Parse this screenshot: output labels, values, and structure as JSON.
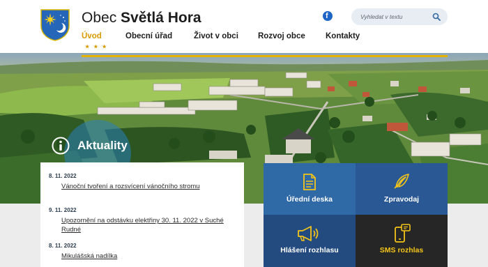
{
  "header": {
    "title_prefix": "Obec",
    "title_name": "Světlá Hora",
    "search": {
      "placeholder": "Vyhledat v textu"
    }
  },
  "nav": {
    "items": [
      {
        "label": "Úvod",
        "active": true
      },
      {
        "label": "Obecní úřad"
      },
      {
        "label": "Život v obci"
      },
      {
        "label": "Rozvoj obce"
      },
      {
        "label": "Kontakty"
      }
    ],
    "active_marker": "★ ★ ★"
  },
  "news": {
    "heading": "Aktuality",
    "items": [
      {
        "date": "8. 11. 2022",
        "title": "Vánoční tvoření a rozsvícení vánočního stromu"
      },
      {
        "date": "9. 11. 2022",
        "title": "Upozornění na odstávku elektřiny 30. 11. 2022 v Suché Rudné"
      },
      {
        "date": "8. 11. 2022",
        "title": "Mikulášská nadílka"
      }
    ]
  },
  "tiles": [
    {
      "label": "Úřední deska",
      "icon": "document-icon",
      "color": "#2f69a6"
    },
    {
      "label": "Zpravodaj",
      "icon": "feather-pen-icon",
      "color": "#2a5894"
    },
    {
      "label": "Hlášení rozhlasu",
      "icon": "megaphone-icon",
      "color": "#234b80"
    },
    {
      "label": "SMS rozhlas",
      "icon": "phone-message-icon",
      "color": "#262626"
    }
  ],
  "colors": {
    "accent_gold": "#e5b200",
    "nav_active": "#d99a00",
    "brand_blue": "#2f69a6"
  }
}
